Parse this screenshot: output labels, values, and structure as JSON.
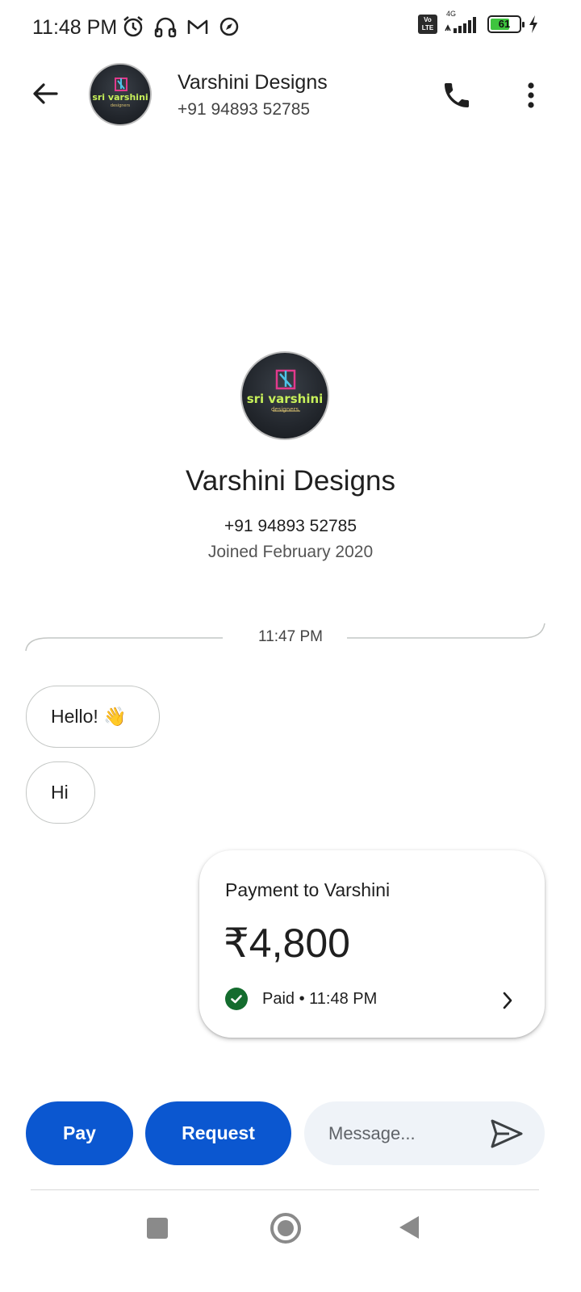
{
  "status_bar": {
    "time": "11:48 PM",
    "left_icons": [
      "alarm-icon",
      "headphones-icon",
      "gmail-icon",
      "compass-icon"
    ],
    "network_label": "4G",
    "volte_label": "Vo LTE",
    "battery_level": "61",
    "charging": true
  },
  "header": {
    "back_icon": "arrow-back-icon",
    "contact_name": "Varshini Designs",
    "contact_phone": "+91 94893 52785",
    "call_icon": "phone-icon",
    "more_icon": "more-vert-icon"
  },
  "avatar_logo": {
    "main": "sri varshini",
    "sub": "designers"
  },
  "profile": {
    "name": "Varshini Designs",
    "phone": "+91 94893 52785",
    "joined": "Joined February 2020"
  },
  "conversation": {
    "divider_time": "11:47 PM",
    "messages": [
      {
        "text": "Hello! 👋",
        "direction": "incoming"
      },
      {
        "text": "Hi",
        "direction": "incoming"
      }
    ]
  },
  "payment_card": {
    "title": "Payment to Varshini",
    "amount": "₹4,800",
    "status": "Paid • 11:48 PM",
    "status_icon": "check-circle-icon",
    "chevron_icon": "chevron-right-icon",
    "status_color": "#146c2e"
  },
  "compose": {
    "pay_label": "Pay",
    "request_label": "Request",
    "message_placeholder": "Message...",
    "send_icon": "send-icon",
    "accent_color": "#0b57d0"
  },
  "nav_bar": {
    "recents_icon": "recents-square-icon",
    "home_icon": "home-circle-icon",
    "back_icon": "back-triangle-icon"
  }
}
